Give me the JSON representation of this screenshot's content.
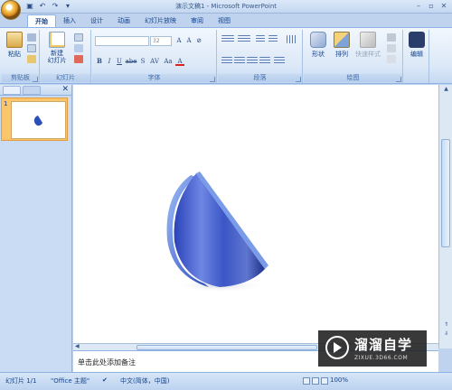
{
  "window": {
    "title": "演示文稿1 - Microsoft PowerPoint",
    "qat": [
      "save-icon",
      "undo-icon",
      "redo-icon",
      "customize-icon"
    ],
    "controls": [
      "minimize-icon",
      "maximize-icon",
      "close-icon"
    ]
  },
  "tabs": [
    {
      "label": "开始",
      "active": true
    },
    {
      "label": "插入"
    },
    {
      "label": "设计"
    },
    {
      "label": "动画"
    },
    {
      "label": "幻灯片放映"
    },
    {
      "label": "审阅"
    },
    {
      "label": "视图"
    }
  ],
  "ribbon": {
    "clipboard": {
      "label": "剪贴板",
      "paste": "粘贴"
    },
    "slides": {
      "label": "幻灯片",
      "new_slide": "新建\n幻灯片"
    },
    "font": {
      "label": "字体",
      "font_name": "",
      "font_size": "32",
      "format_buttons": [
        "B",
        "I",
        "U",
        "abe",
        "S",
        "AV",
        "Aa",
        "A"
      ]
    },
    "paragraph": {
      "label": "段落"
    },
    "drawing": {
      "label": "绘图",
      "shapes": "形状",
      "arrange": "排列",
      "quick_styles": "快速样式"
    },
    "editing": {
      "label": "编辑"
    }
  },
  "slides_panel": {
    "slide_number": "1"
  },
  "notes": {
    "placeholder": "单击此处添加备注"
  },
  "status": {
    "slide": "幻灯片 1/1",
    "theme": "\"Office 主题\"",
    "language": "中文(简体，中国)",
    "zoom": "100%"
  },
  "watermark": {
    "brand": "溜溜自学",
    "url": "ZIXUE.3D66.COM"
  },
  "colors": {
    "accent": "#15428b",
    "shape_dark": "#1b2f8f",
    "shape_mid": "#4a6fd6",
    "shape_light": "#7fa7ee"
  }
}
